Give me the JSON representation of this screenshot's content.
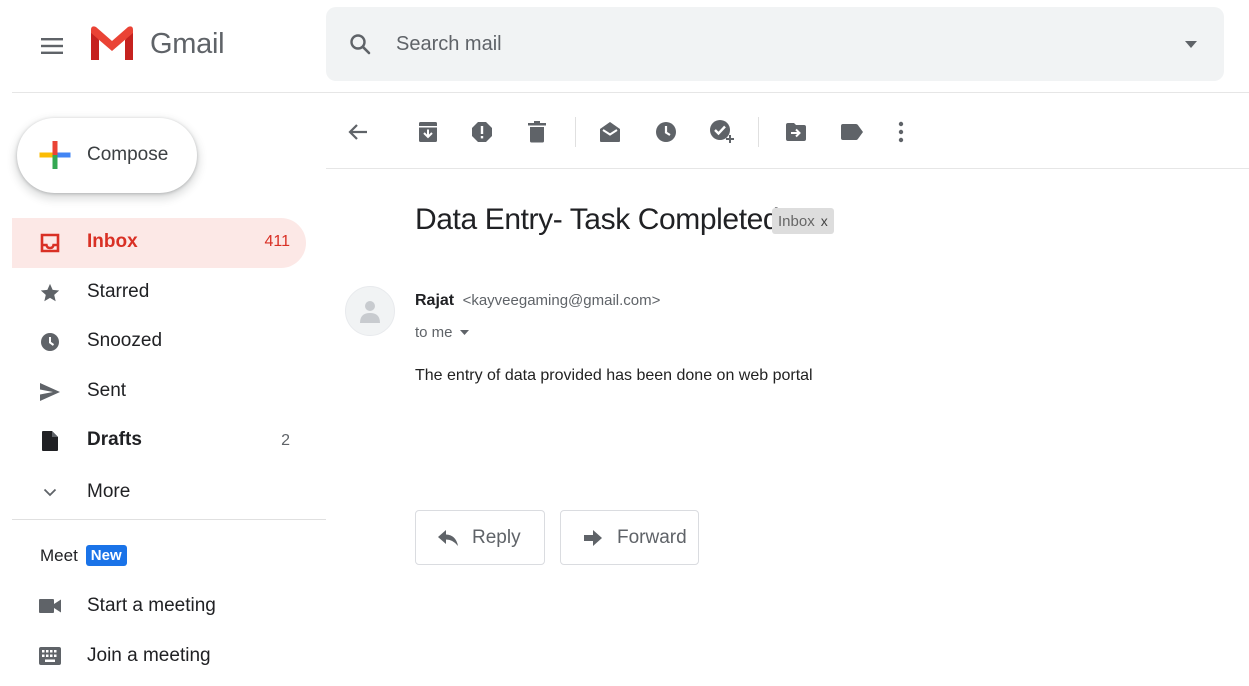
{
  "app": {
    "name": "Gmail"
  },
  "search": {
    "placeholder": "Search mail"
  },
  "compose": {
    "label": "Compose"
  },
  "nav": {
    "items": [
      {
        "label": "Inbox",
        "count": "411",
        "icon": "inbox-icon"
      },
      {
        "label": "Starred",
        "count": "",
        "icon": "star-icon"
      },
      {
        "label": "Snoozed",
        "count": "",
        "icon": "clock-icon"
      },
      {
        "label": "Sent",
        "count": "",
        "icon": "send-icon"
      },
      {
        "label": "Drafts",
        "count": "2",
        "icon": "draft-icon"
      },
      {
        "label": "More",
        "count": "",
        "icon": "chevron-down-icon"
      }
    ]
  },
  "meet": {
    "title": "Meet",
    "badge": "New",
    "items": [
      {
        "label": "Start a meeting",
        "icon": "video-icon"
      },
      {
        "label": "Join a meeting",
        "icon": "keyboard-icon"
      }
    ]
  },
  "toolbar": {
    "icons": [
      "back-arrow-icon",
      "archive-icon",
      "report-spam-icon",
      "delete-icon",
      "mark-unread-icon",
      "snooze-icon",
      "add-to-tasks-icon",
      "move-to-icon",
      "label-icon",
      "more-vert-icon"
    ]
  },
  "message": {
    "subject": "Data Entry- Task Completed",
    "label": "Inbox",
    "label_close": "x",
    "sender_name": "Rajat",
    "sender_email": "<kayveegaming@gmail.com>",
    "recipient": "to me",
    "body": "The entry of data provided has been done on web portal",
    "reply_label": "Reply",
    "forward_label": "Forward"
  },
  "colors": {
    "accent_red": "#d93025",
    "active_bg": "#fce8e6",
    "meet_badge": "#1a73e8",
    "search_bg": "#f1f3f4"
  }
}
